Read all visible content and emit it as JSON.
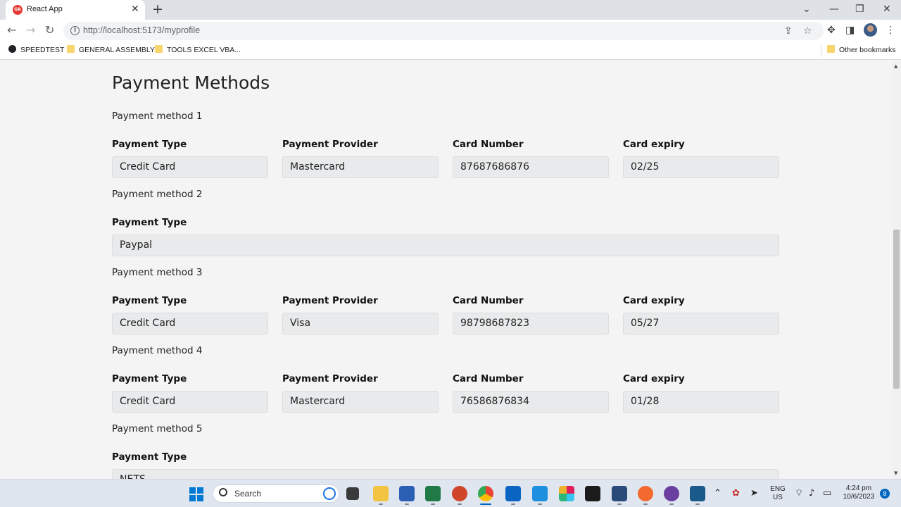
{
  "browser": {
    "tab_title": "React App",
    "tab_favicon_text": "GA",
    "new_tab_symbol": "+",
    "close_tab_symbol": "✕",
    "url": "http://localhost:5173/myprofile",
    "bookmarks": [
      {
        "label": "SPEEDTEST",
        "icon": "speedtest-icon"
      },
      {
        "label": "GENERAL ASSEMBLY",
        "icon": "folder-icon"
      },
      {
        "label": "TOOLS EXCEL VBA...",
        "icon": "folder-icon"
      }
    ],
    "other_bookmarks": "Other bookmarks"
  },
  "page": {
    "title": "Payment Methods",
    "methods": [
      {
        "label": "Payment method 1",
        "fields": [
          {
            "label": "Payment Type",
            "value": "Credit Card"
          },
          {
            "label": "Payment Provider",
            "value": "Mastercard"
          },
          {
            "label": "Card Number",
            "value": "87687686876"
          },
          {
            "label": "Card expiry",
            "value": "02/25"
          }
        ]
      },
      {
        "label": "Payment method 2",
        "fields": [
          {
            "label": "Payment Type",
            "value": "Paypal"
          }
        ]
      },
      {
        "label": "Payment method 3",
        "fields": [
          {
            "label": "Payment Type",
            "value": "Credit Card"
          },
          {
            "label": "Payment Provider",
            "value": "Visa"
          },
          {
            "label": "Card Number",
            "value": "98798687823"
          },
          {
            "label": "Card expiry",
            "value": "05/27"
          }
        ]
      },
      {
        "label": "Payment method 4",
        "fields": [
          {
            "label": "Payment Type",
            "value": "Credit Card"
          },
          {
            "label": "Payment Provider",
            "value": "Mastercard"
          },
          {
            "label": "Card Number",
            "value": "76586876834"
          },
          {
            "label": "Card expiry",
            "value": "01/28"
          }
        ]
      },
      {
        "label": "Payment method 5",
        "fields": [
          {
            "label": "Payment Type",
            "value": "NETS"
          }
        ]
      }
    ]
  },
  "taskbar": {
    "search_placeholder": "Search",
    "language": "ENG",
    "region": "US",
    "time": "4:24 pm",
    "date": "10/6/2023",
    "notification_count": "8"
  },
  "colors": {
    "page_background": "#f4f4f4",
    "field_background": "#e9eaeb",
    "accent": "#0067c0"
  }
}
